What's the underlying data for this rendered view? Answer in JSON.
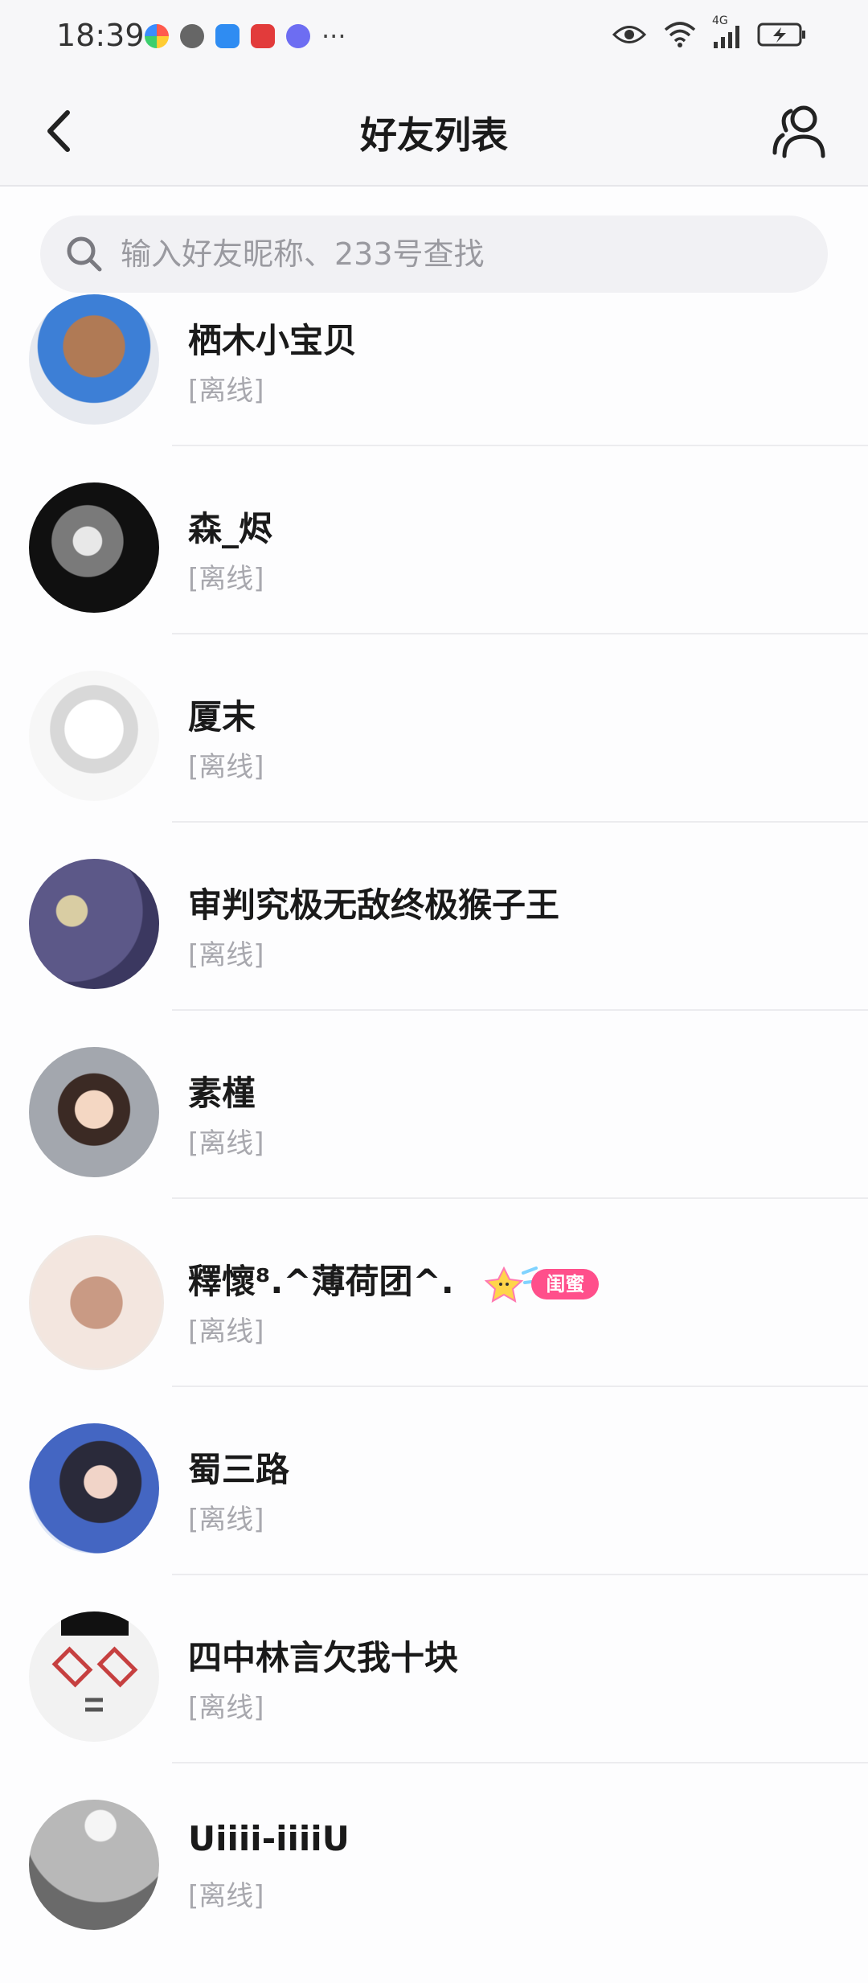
{
  "status_bar": {
    "time": "18:39",
    "network": "4G",
    "more": "···"
  },
  "header": {
    "title": "好友列表"
  },
  "search": {
    "placeholder": "输入好友昵称、233号查找"
  },
  "friends": [
    {
      "name": "栖木小宝贝",
      "status": "[离线]",
      "avatar_colors": [
        "#8a5a3c",
        "#3d7fd6"
      ]
    },
    {
      "name": "森_烬",
      "status": "[离线]",
      "avatar_colors": [
        "#111111",
        "#6b6b6b"
      ]
    },
    {
      "name": "厦末",
      "status": "[离线]",
      "avatar_colors": [
        "#f5f5f5",
        "#cfcfcf"
      ]
    },
    {
      "name": "审判究极无敌终极猴子王",
      "status": "[离线]",
      "avatar_colors": [
        "#4e4a7a",
        "#b9b4d8"
      ]
    },
    {
      "name": "素槿",
      "status": "[离线]",
      "avatar_colors": [
        "#9aa0a8",
        "#3b2a24"
      ]
    },
    {
      "name": "釋懷⁸.^薄荷团^.",
      "status": "[离线]",
      "avatar_colors": [
        "#f3e6df",
        "#c99a84"
      ],
      "badge": "闺蜜"
    },
    {
      "name": "蜀三路",
      "status": "[离线]",
      "avatar_colors": [
        "#3c5bb0",
        "#dfe7f7"
      ]
    },
    {
      "name": "四中林言欠我十块",
      "status": "[离线]",
      "avatar_colors": [
        "#f2f2f2",
        "#d24a4a"
      ]
    },
    {
      "name": "Uiiii-iiiiU",
      "status": "[离线]",
      "avatar_colors": [
        "#b8b8b8",
        "#6a6a6a"
      ]
    }
  ]
}
